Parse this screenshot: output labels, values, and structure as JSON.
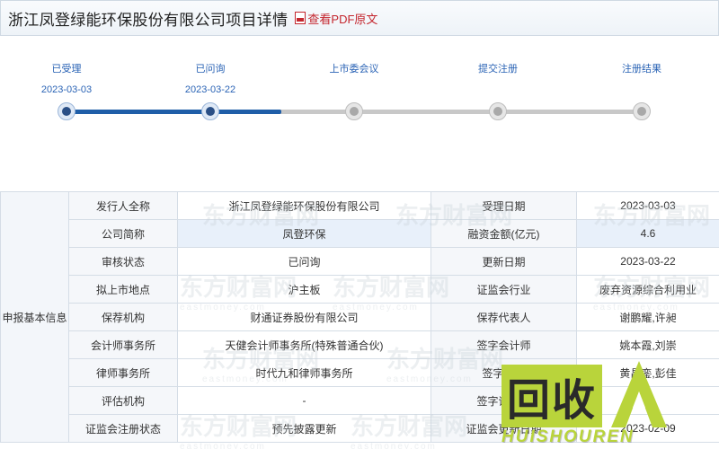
{
  "header": {
    "title": "浙江凤登绿能环保股份有限公司项目详情",
    "pdf_link": "查看PDF原文",
    "pdf_icon": "pdf-icon"
  },
  "progress": {
    "steps": [
      {
        "label": "已受理",
        "date": "2023-03-03",
        "done": true
      },
      {
        "label": "已问询",
        "date": "2023-03-22",
        "done": true
      },
      {
        "label": "上市委会议",
        "date": "",
        "done": false
      },
      {
        "label": "提交注册",
        "date": "",
        "done": false
      },
      {
        "label": "注册结果",
        "date": "",
        "done": false
      }
    ],
    "completion_fraction": 0.375,
    "colors": {
      "active": "#1f5ea8",
      "inactive": "#c8c8c8",
      "label": "#2a63b5"
    }
  },
  "info": {
    "section_label": "申报基本信息",
    "rows": [
      {
        "k1": "发行人全称",
        "v1": "浙江凤登绿能环保股份有限公司",
        "k2": "受理日期",
        "v2": "2023-03-03"
      },
      {
        "k1": "公司简称",
        "v1": "凤登环保",
        "k2": "融资金额(亿元)",
        "v2": "4.6"
      },
      {
        "k1": "审核状态",
        "v1": "已问询",
        "k2": "更新日期",
        "v2": "2023-03-22"
      },
      {
        "k1": "拟上市地点",
        "v1": "沪主板",
        "k2": "证监会行业",
        "v2": "废弃资源综合利用业"
      },
      {
        "k1": "保荐机构",
        "v1": "财通证券股份有限公司",
        "k2": "保荐代表人",
        "v2": "谢鹏耀,许昶"
      },
      {
        "k1": "会计师事务所",
        "v1": "天健会计师事务所(特殊普通合伙)",
        "k2": "签字会计师",
        "v2": "姚本霞,刘崇"
      },
      {
        "k1": "律师事务所",
        "v1": "时代九和律师事务所",
        "k2": "签字律师",
        "v2": "黄昌銮,彭佳"
      },
      {
        "k1": "评估机构",
        "v1": "-",
        "k2": "签字评估师",
        "v2": "-"
      },
      {
        "k1": "证监会注册状态",
        "v1": "预先披露更新",
        "k2": "证监会更新日期",
        "v2": "2023-02-09"
      }
    ]
  },
  "watermark": {
    "cn_text": "东方财富网",
    "en_text": "eastmoney.com"
  },
  "logo": {
    "box_text": "回收",
    "letter": "A",
    "brand_text": "HUISHOUREN"
  }
}
